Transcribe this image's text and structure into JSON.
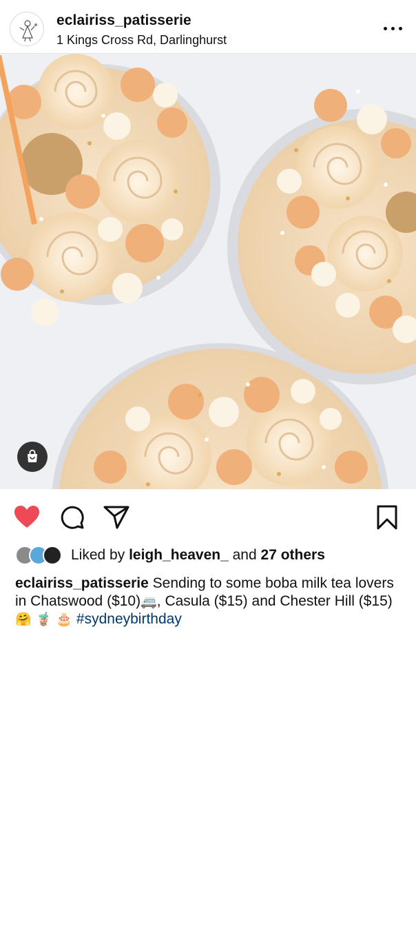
{
  "post": {
    "username": "eclairiss_patisserie",
    "location": "1 Kings Cross Rd, Darlinghurst",
    "likes": {
      "prefix": "Liked by ",
      "user": "leigh_heaven_",
      "middle": " and ",
      "others": "27 others"
    },
    "caption": {
      "username": "eclairiss_patisserie",
      "part1": " Sending to some boba milk tea lovers in Chatswood ($10)",
      "emoji_van": "🚐",
      "part2": ", Casula ($15) and Chester Hill ($15) ",
      "emoji_end": "🤗 🧋 🎂",
      "hashtag": "#sydneybirthday"
    }
  },
  "icons": {
    "more": "more-horizontal-icon",
    "shop": "shopping-bag-icon",
    "like": "heart-filled-icon",
    "comment": "comment-icon",
    "share": "send-icon",
    "save": "bookmark-icon"
  },
  "colors": {
    "like": "#ed4956",
    "hashtag": "#00376b"
  }
}
